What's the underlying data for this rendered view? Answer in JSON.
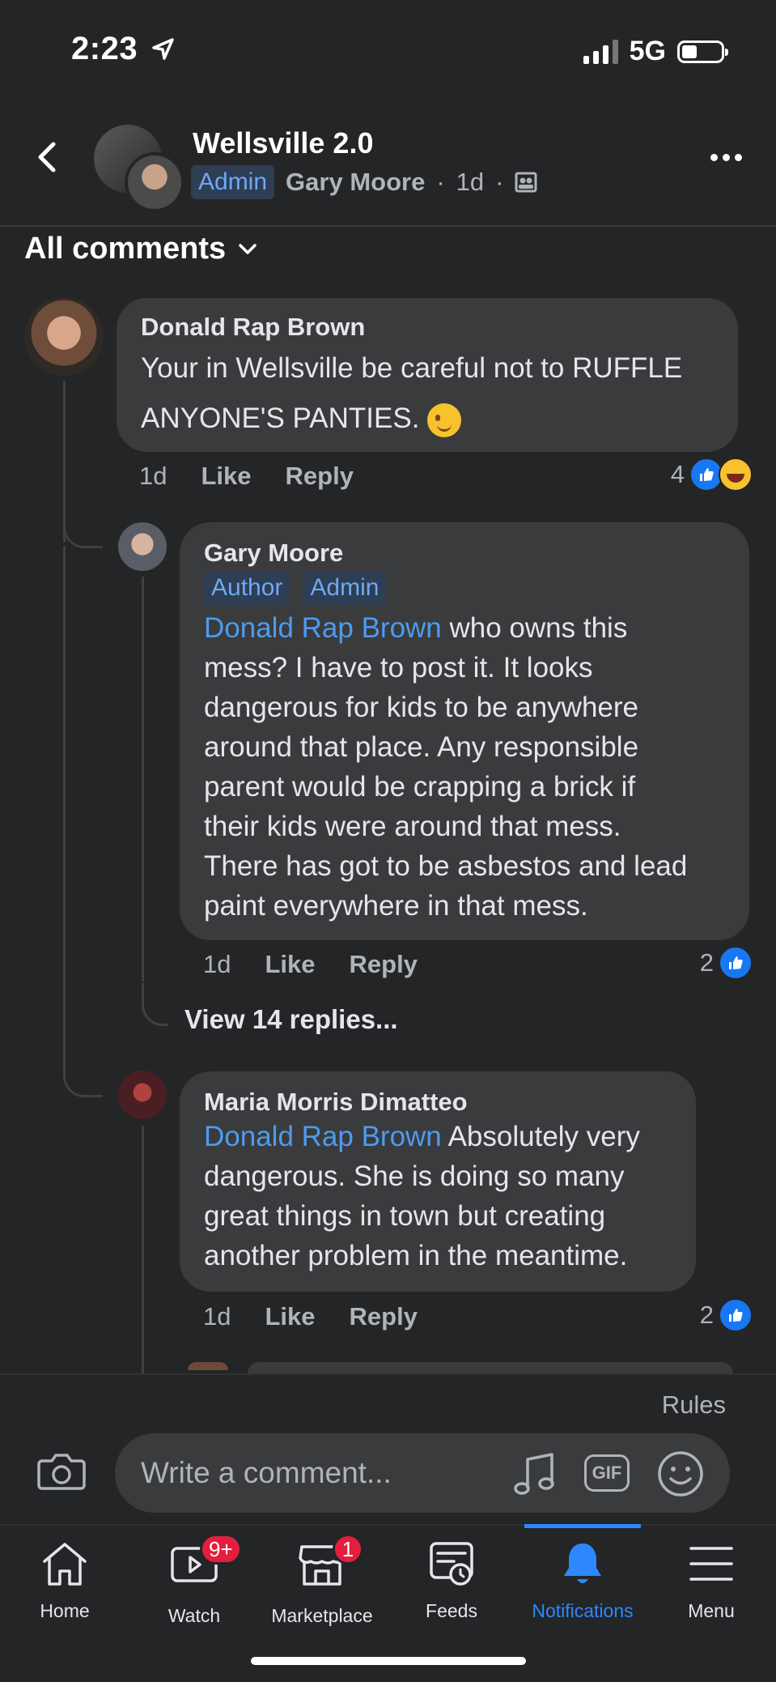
{
  "status_bar": {
    "time": "2:23",
    "network": "5G"
  },
  "header": {
    "group_name": "Wellsville 2.0",
    "poster_badge": "Admin",
    "poster_name": "Gary Moore",
    "time": "1d"
  },
  "filter": {
    "label": "All comments"
  },
  "comments": [
    {
      "author": "Donald Rap Brown",
      "text": "Your in Wellsville be careful not to RUFFLE\nANYONE'S PANTIES.",
      "time": "1d",
      "like": "Like",
      "reply": "Reply",
      "reaction_count": "4"
    },
    {
      "author": "Gary Moore",
      "badges": [
        "Author",
        "Admin"
      ],
      "mention": "Donald Rap Brown",
      "text_first": " who owns this",
      "text": "mess? I have to post it.  It looks\ndangerous for kids to be anywhere\naround that place. Any responsible\nparent would be crapping a brick if\ntheir kids were around that mess.\nThere has got to be asbestos and lead\npaint everywhere in that mess.",
      "time": "1d",
      "like": "Like",
      "reply": "Reply",
      "reaction_count": "2"
    },
    {
      "author": "Maria Morris Dimatteo",
      "mention": "Donald Rap Brown",
      "text_first": " Absolutely very",
      "text": "dangerous.  She is doing so many\ngreat things in town but creating\nanother problem in the meantime.",
      "time": "1d",
      "like": "Like",
      "reply": "Reply",
      "reaction_count": "2"
    }
  ],
  "view_replies": "View 14 replies...",
  "composer": {
    "rules": "Rules",
    "placeholder": "Write a comment...",
    "gif_label": "GIF"
  },
  "tabs": [
    {
      "label": "Home",
      "icon": "home-icon"
    },
    {
      "label": "Watch",
      "icon": "watch-icon",
      "badge": "9+"
    },
    {
      "label": "Marketplace",
      "icon": "marketplace-icon",
      "badge": "1"
    },
    {
      "label": "Feeds",
      "icon": "feeds-icon"
    },
    {
      "label": "Notifications",
      "icon": "bell-icon",
      "active": true
    },
    {
      "label": "Menu",
      "icon": "menu-icon"
    }
  ],
  "colors": {
    "background": "#242526",
    "bubble": "#3a3b3c",
    "accent": "#2d88ff",
    "mention": "#4d9bf0",
    "badge_red": "#e41e3f"
  }
}
